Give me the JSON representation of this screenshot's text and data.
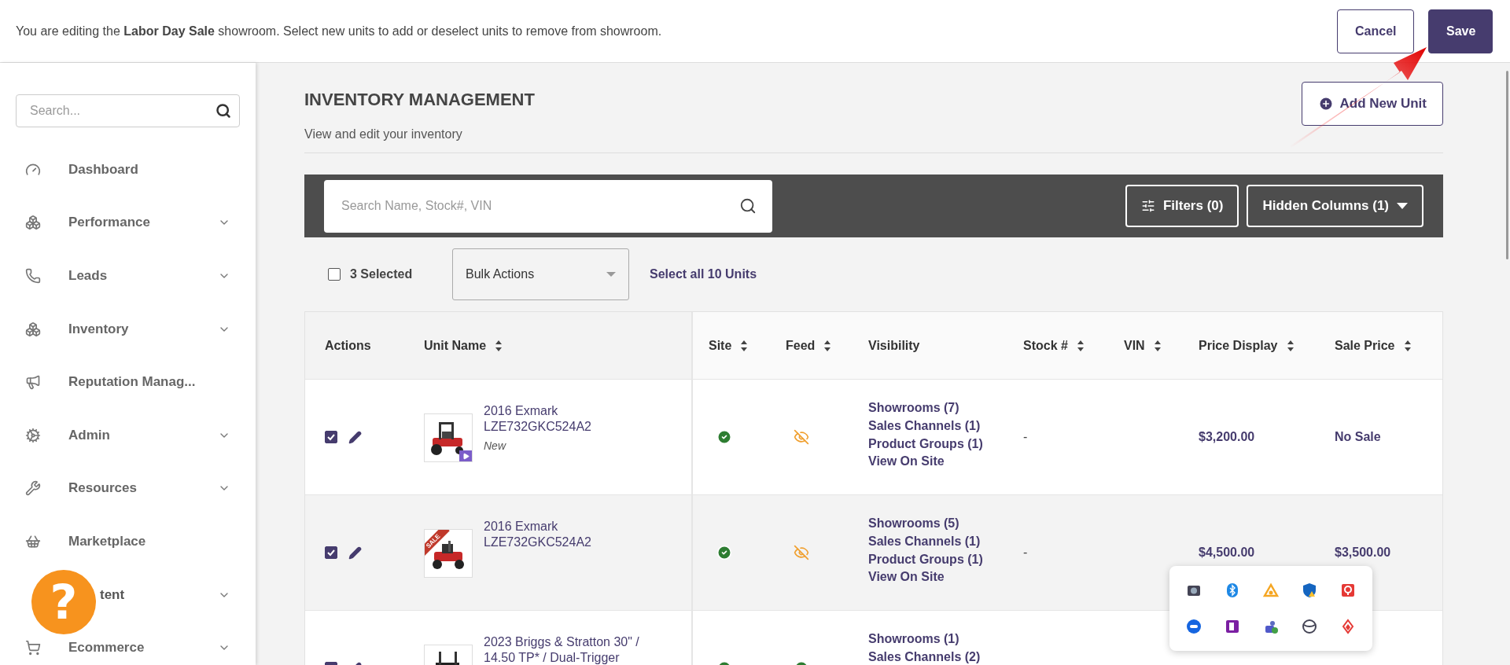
{
  "banner": {
    "message": "You are editing the **Labor Day Sale** showroom. Select new units to add or deselect units to remove from showroom.",
    "buttons": [
      {
        "label": "Cancel",
        "kind": "secondary"
      },
      {
        "label": "Save",
        "kind": "primary"
      }
    ]
  },
  "sidebar": {
    "search": {
      "placeholder": "Search..."
    },
    "items": [
      {
        "label": "Dashboard",
        "expandable": false,
        "covered": false
      },
      {
        "label": "Performance",
        "expandable": true,
        "covered": false
      },
      {
        "label": "Leads",
        "expandable": true,
        "covered": false
      },
      {
        "label": "Inventory",
        "expandable": true,
        "covered": false
      },
      {
        "label": "Reputation Manag...",
        "expandable": false,
        "covered": false
      },
      {
        "label": "Admin",
        "expandable": true,
        "covered": false
      },
      {
        "label": "Resources",
        "expandable": true,
        "covered": false
      },
      {
        "label": "Marketplace",
        "expandable": false,
        "covered": false
      },
      {
        "label": "tent",
        "expandable": true,
        "covered": true
      },
      {
        "label": "Ecommerce",
        "expandable": true,
        "covered": false
      }
    ]
  },
  "help_button": {
    "label": "?"
  },
  "header": {
    "title": "INVENTORY MANAGEMENT",
    "subtitle": "View and edit your inventory",
    "add_button": "Add New Unit"
  },
  "toolbar": {
    "search": {
      "placeholder": "Search Name, Stock#, VIN"
    },
    "filters": "Filters (0)",
    "hidden_columns": "Hidden Columns (1)"
  },
  "selection": {
    "checked": false,
    "label": "3 Selected",
    "bulk_actions": "Bulk Actions",
    "select_all": "Select all 10 Units"
  },
  "table": {
    "columns": [
      {
        "label": "Actions",
        "sortable": false
      },
      {
        "label": "Unit Name",
        "sortable": true
      },
      {
        "label": "Site",
        "sortable": true
      },
      {
        "label": "Feed",
        "sortable": true
      },
      {
        "label": "Visibility",
        "sortable": false
      },
      {
        "label": "Stock #",
        "sortable": true
      },
      {
        "label": "VIN",
        "sortable": true
      },
      {
        "label": "Price Display",
        "sortable": true
      },
      {
        "label": "Sale Price",
        "sortable": true
      }
    ],
    "rows": [
      {
        "checked": true,
        "name": "2016 Exmark LZE732GKC524A2",
        "note": "New",
        "badge": {
          "kind": "video"
        },
        "site_live": true,
        "feed_live": false,
        "visibility": [
          "Showrooms (7)",
          "Sales Channels (1)",
          "Product Groups (1)",
          "View On Site"
        ],
        "stock": "-",
        "price": "$3,200.00",
        "sale_price": "No Sale",
        "shaded": false
      },
      {
        "checked": true,
        "name": "2016 Exmark LZE732GKC524A2",
        "badge": {
          "kind": "ribbon",
          "label": "SALE"
        },
        "site_live": true,
        "feed_live": false,
        "visibility": [
          "Showrooms (5)",
          "Sales Channels (1)",
          "Product Groups (1)",
          "View On Site"
        ],
        "stock": "-",
        "price": "$4,500.00",
        "sale_price": "$3,500.00",
        "shaded": true
      },
      {
        "checked": true,
        "name": "2023 Briggs & Stratton 30\" / 14.50 TP* / Dual-Trigger",
        "site_live": true,
        "feed_live": true,
        "visibility": [
          "Showrooms (1)",
          "Sales Channels (2)"
        ],
        "shaded": false
      }
    ]
  }
}
